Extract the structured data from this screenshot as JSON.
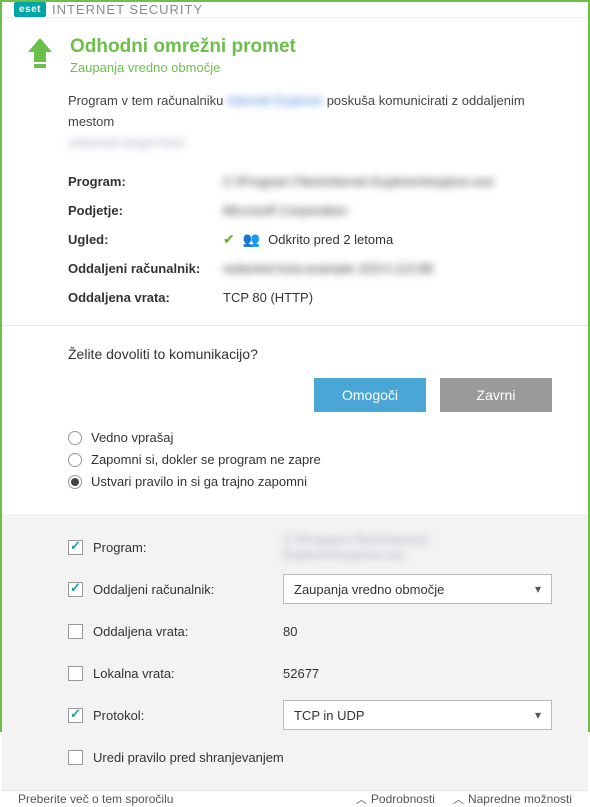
{
  "titlebar": {
    "logo": "eset",
    "product": "INTERNET SECURITY"
  },
  "header": {
    "title": "Odhodni omrežni promet",
    "subtitle": "Zaupanja vredno območje"
  },
  "intro": {
    "part1": "Program v tem računalniku ",
    "blurred_app": "Internet Explorer",
    "part2": " poskuša komunicirati z oddaljenim mestom",
    "blurred_line2": "redacted target host"
  },
  "info": {
    "program_label": "Program:",
    "program_value": "C:\\Program Files\\Internet Explorer\\iexplore.exe",
    "company_label": "Podjetje:",
    "company_value": "Microsoft Corporation",
    "reputation_label": "Ugled:",
    "reputation_value": "Odkrito pred 2 letoma",
    "remote_label": "Oddaljeni računalnik:",
    "remote_value": "redacted.host.example 203.0.113.88",
    "port_label": "Oddaljena vrata:",
    "port_value": "TCP 80 (HTTP)"
  },
  "question": "Želite dovoliti to komunikacijo?",
  "buttons": {
    "allow": "Omogoči",
    "deny": "Zavrni"
  },
  "radios": {
    "ask": "Vedno vprašaj",
    "remember_close": "Zapomni si, dokler se program ne zapre",
    "create_rule": "Ustvari pravilo in si ga trajno zapomni"
  },
  "rule": {
    "program_label": "Program:",
    "program_value": "C:\\Program Files\\Internet Explorer\\iexplore.exe",
    "remote_label": "Oddaljeni računalnik:",
    "remote_select": "Zaupanja vredno območje",
    "remote_port_label": "Oddaljena vrata:",
    "remote_port_value": "80",
    "local_port_label": "Lokalna vrata:",
    "local_port_value": "52677",
    "protocol_label": "Protokol:",
    "protocol_select": "TCP in UDP",
    "edit_label": "Uredi pravilo pred shranjevanjem"
  },
  "footer": {
    "read_more": "Preberite več o tem sporočilu",
    "details": "Podrobnosti",
    "advanced": "Napredne možnosti"
  }
}
